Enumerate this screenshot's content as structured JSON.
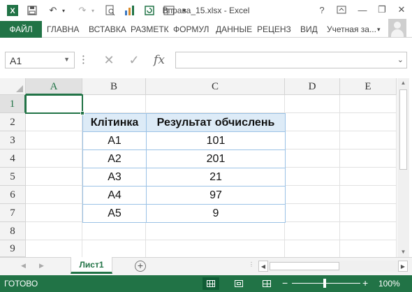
{
  "window": {
    "title": "Вправа_15.xlsx - Excel",
    "help": "?",
    "minimize": "—",
    "restore": "❐",
    "close": "✕"
  },
  "quick_access": {
    "save_icon": "▪",
    "undo": "↶",
    "redo": "↷",
    "print_preview": "▢",
    "chart": "▌",
    "more": "▾"
  },
  "ribbon": {
    "file": "ФАЙЛ",
    "tabs": [
      "ГЛАВНА",
      "ВСТАВКА",
      "РАЗМЕТК",
      "ФОРМУЛ",
      "ДАННЫЕ",
      "РЕЦЕНЗ",
      "ВИД"
    ],
    "account": "Учетная за...",
    "account_arrow": "▾"
  },
  "formula_bar": {
    "name_box": "A1",
    "name_arrow": "▼",
    "cancel": "✕",
    "enter": "✓",
    "fx": "fx",
    "formula": "",
    "expand": "⌄"
  },
  "sheet": {
    "columns": [
      "A",
      "B",
      "C",
      "D",
      "E"
    ],
    "rows": [
      "1",
      "2",
      "3",
      "4",
      "5",
      "6",
      "7",
      "8",
      "9"
    ],
    "selected_cell": "A1",
    "table": {
      "headers": [
        "Клітинка",
        "Результат обчислень"
      ],
      "rows": [
        [
          "A1",
          "101"
        ],
        [
          "A2",
          "201"
        ],
        [
          "A3",
          "21"
        ],
        [
          "A4",
          "97"
        ],
        [
          "A5",
          "9"
        ]
      ]
    }
  },
  "sheet_tabs": {
    "prev": "◀",
    "next": "▶",
    "active": "Лист1",
    "add": "+"
  },
  "status_bar": {
    "ready": "ГОТОВО",
    "zoom_out": "−",
    "zoom_in": "+",
    "zoom": "100%"
  },
  "colors": {
    "accent": "#217346",
    "table_border": "#9bc2e6",
    "table_header": "#ddebf7"
  }
}
